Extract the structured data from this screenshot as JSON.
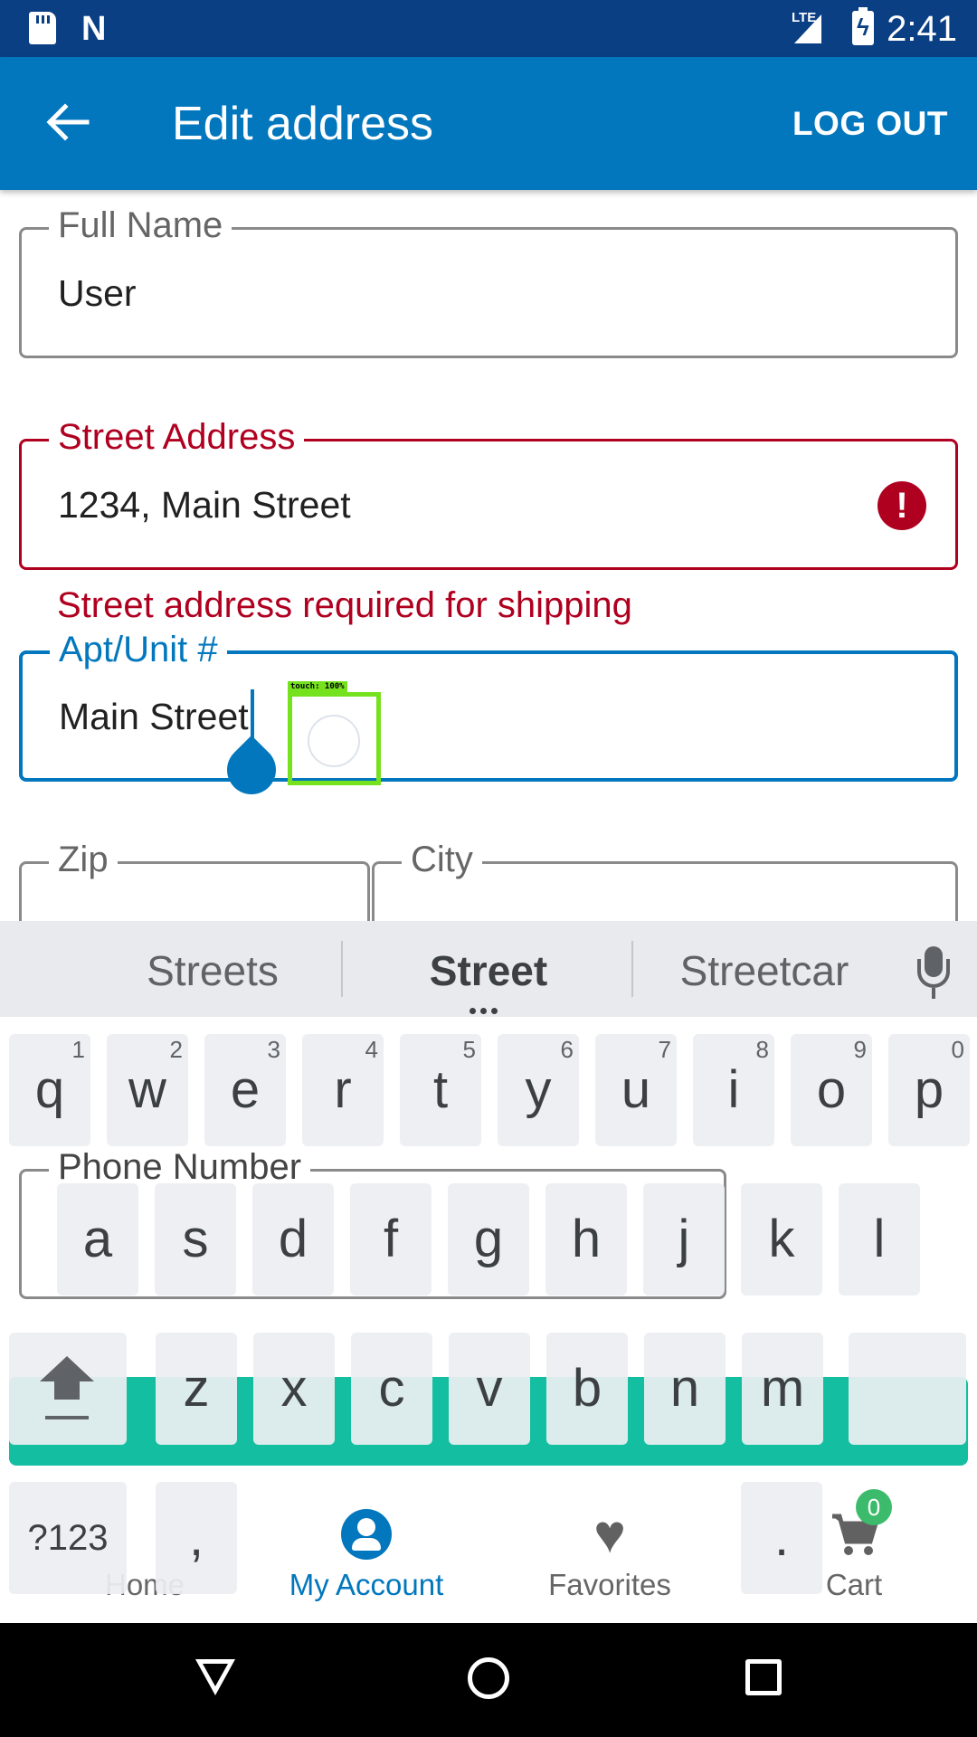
{
  "status_bar": {
    "time": "2:41",
    "network": "LTE"
  },
  "toolbar": {
    "title": "Edit address",
    "logout_label": "LOG OUT"
  },
  "form": {
    "full_name": {
      "label": "Full Name",
      "value": "User"
    },
    "street": {
      "label": "Street Address",
      "value": "1234, Main Street",
      "error": "Street address required for shipping"
    },
    "apt": {
      "label": "Apt/Unit #",
      "value": "Main Street"
    },
    "zip": {
      "label": "Zip"
    },
    "city": {
      "label": "City"
    },
    "phone": {
      "label": "Phone Number"
    }
  },
  "touch_indicator": "touch: 100%",
  "keyboard": {
    "suggestions": [
      "Streets",
      "Street",
      "Streetcar"
    ],
    "row1": [
      {
        "k": "q",
        "h": "1"
      },
      {
        "k": "w",
        "h": "2"
      },
      {
        "k": "e",
        "h": "3"
      },
      {
        "k": "r",
        "h": "4"
      },
      {
        "k": "t",
        "h": "5"
      },
      {
        "k": "y",
        "h": "6"
      },
      {
        "k": "u",
        "h": "7"
      },
      {
        "k": "i",
        "h": "8"
      },
      {
        "k": "o",
        "h": "9"
      },
      {
        "k": "p",
        "h": "0"
      }
    ],
    "row2": [
      "a",
      "s",
      "d",
      "f",
      "g",
      "h",
      "j",
      "k",
      "l"
    ],
    "row3": [
      "z",
      "x",
      "c",
      "v",
      "b",
      "n",
      "m"
    ],
    "symbols_label": "?123",
    "comma_label": ",",
    "period_label": "."
  },
  "bottom_nav": {
    "home": "Home",
    "account": "My Account",
    "favorites": "Favorites",
    "cart": "Cart",
    "cart_count": "0"
  },
  "colors": {
    "primary": "#0277bd",
    "error": "#b00020",
    "accent": "#14bfa1",
    "status_bar": "#0b3f84"
  }
}
